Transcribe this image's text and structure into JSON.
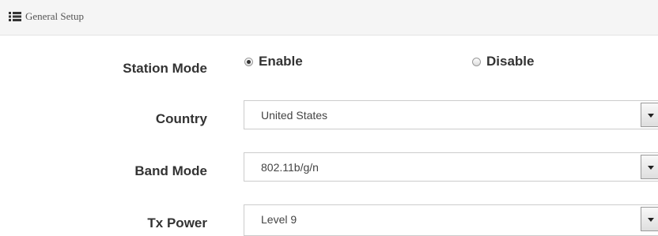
{
  "header": {
    "title": "General Setup",
    "icon": "list-icon"
  },
  "station_mode": {
    "label": "Station Mode",
    "options": [
      {
        "label": "Enable",
        "checked": true
      },
      {
        "label": "Disable",
        "checked": false
      }
    ]
  },
  "country": {
    "label": "Country",
    "value": "United States"
  },
  "band_mode": {
    "label": "Band Mode",
    "value": "802.11b/g/n"
  },
  "tx_power": {
    "label": "Tx Power",
    "value": "Level 9"
  }
}
